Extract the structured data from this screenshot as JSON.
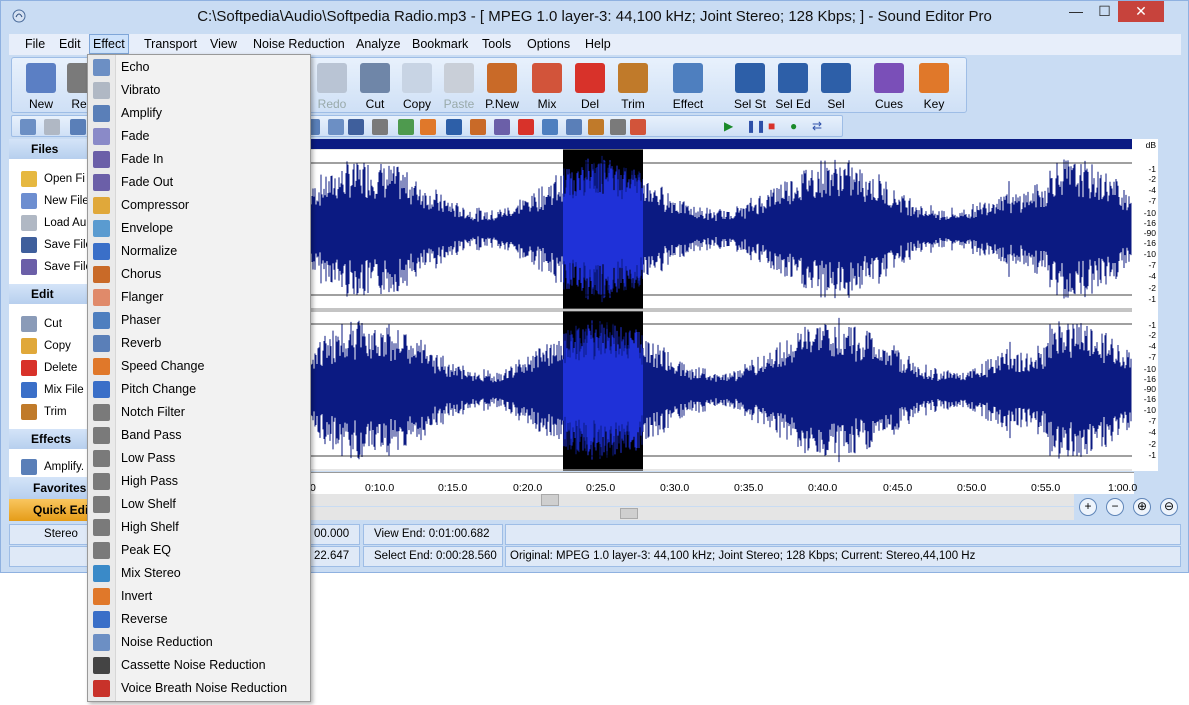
{
  "window": {
    "title": "C:\\Softpedia\\Audio\\Softpedia Radio.mp3 - [ MPEG 1.0 layer-3: 44,100 kHz; Joint Stereo; 128 Kbps;  ] - Sound Editor Pro",
    "minimize": "—",
    "maximize": "☐",
    "close": "✕"
  },
  "menubar": [
    "File",
    "Edit",
    "Effect",
    "Transport",
    "View",
    "Noise Reduction",
    "Analyze",
    "Bookmark",
    "Tools",
    "Options",
    "Help"
  ],
  "toolbar": [
    {
      "label": "New",
      "icon": "new-icon",
      "color": "#5b7fc4"
    },
    {
      "label": "Rec",
      "icon": "record-icon",
      "color": "#7a7a7a"
    },
    {
      "label": "Redo",
      "icon": "redo-icon",
      "color": "#b9c4d4",
      "disabled": true
    },
    {
      "label": "Cut",
      "icon": "scissors-icon",
      "color": "#6f86a8"
    },
    {
      "label": "Copy",
      "icon": "copy-icon",
      "color": "#c8d4e4"
    },
    {
      "label": "Paste",
      "icon": "paste-icon",
      "color": "#c9cfd8",
      "disabled": true
    },
    {
      "label": "P.New",
      "icon": "paste-new-icon",
      "color": "#c96a28"
    },
    {
      "label": "Mix",
      "icon": "mix-icon",
      "color": "#d2543a"
    },
    {
      "label": "Del",
      "icon": "delete-icon",
      "color": "#d8322a"
    },
    {
      "label": "Trim",
      "icon": "trim-icon",
      "color": "#c07a2a"
    },
    {
      "label": "Effect",
      "icon": "effect-icon",
      "color": "#4e7fbf"
    },
    {
      "label": "Sel St",
      "icon": "select-start-icon",
      "color": "#2d5fa8"
    },
    {
      "label": "Sel Ed",
      "icon": "select-end-icon",
      "color": "#2d5fa8"
    },
    {
      "label": "Sel",
      "icon": "select-icon",
      "color": "#2d5fa8"
    },
    {
      "label": "Cues",
      "icon": "cues-icon",
      "color": "#7a4fb8"
    },
    {
      "label": "Key",
      "icon": "key-icon",
      "color": "#e0782a"
    }
  ],
  "sidebar": {
    "files_header": "Files",
    "files": [
      "Open Fi",
      "New File",
      "Load Au",
      "Save File",
      "Save File"
    ],
    "edit_header": "Edit",
    "edit": [
      "Cut",
      "Copy",
      "Delete",
      "Mix File",
      "Trim"
    ],
    "effects_header": "Effects",
    "effects": [
      "Amplify."
    ],
    "favorites": "Favorites",
    "quick_edit": "Quick Edit"
  },
  "effect_menu": [
    "Echo",
    "Vibrato",
    "Amplify",
    "Fade",
    "Fade In",
    "Fade Out",
    "Compressor",
    "Envelope",
    "Normalize",
    "Chorus",
    "Flanger",
    "Phaser",
    "Reverb",
    "Speed Change",
    "Pitch Change",
    "Notch Filter",
    "Band Pass",
    "Low Pass",
    "High Pass",
    "Low Shelf",
    "High Shelf",
    "Peak EQ",
    "Mix Stereo",
    "Invert",
    "Reverse",
    "Noise Reduction",
    "Cassette Noise Reduction",
    "Voice Breath Noise Reduction"
  ],
  "timeline": [
    "0",
    "0:10.0",
    "0:15.0",
    "0:20.0",
    "0:25.0",
    "0:30.0",
    "0:35.0",
    "0:40.0",
    "0:45.0",
    "0:50.0",
    "0:55.0",
    "1:00.0"
  ],
  "db_scale": {
    "unit": "dB",
    "top": [
      "-1",
      "-2",
      "-4",
      "-7",
      "-10",
      "-16",
      "-90",
      "-16",
      "-10",
      "-7",
      "-4",
      "-2",
      "-1"
    ],
    "bottom": [
      "-1",
      "-2",
      "-4",
      "-7",
      "-10",
      "-16",
      "-90",
      "-16",
      "-10",
      "-7",
      "-4",
      "-2",
      "-1"
    ]
  },
  "status": {
    "channel": "Stereo",
    "view_start": "00.000",
    "view_end": "View End: 0:01:00.682",
    "select_start": "22.647",
    "select_end": "Select End: 0:00:28.560",
    "info": "Original: MPEG 1.0 layer-3: 44,100 kHz; Joint Stereo; 128 Kbps;  Current: Stereo,44,100 Hz"
  },
  "waveform": {
    "color": "#0b1a82",
    "selection_color": "#1f31d8",
    "selection_start": 22.647,
    "selection_end": 28.56,
    "duration": 60.682
  },
  "zoom": [
    "zoom-in-h-icon",
    "zoom-out-h-icon",
    "zoom-in-v-icon",
    "zoom-out-v-icon"
  ]
}
